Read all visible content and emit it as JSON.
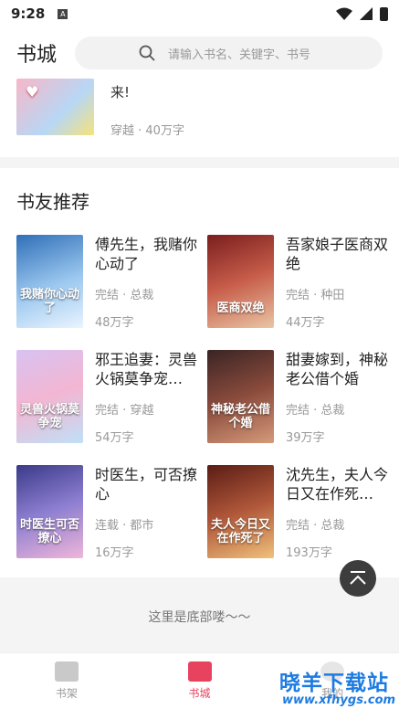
{
  "status": {
    "time": "9:28"
  },
  "header": {
    "title": "书城",
    "search_placeholder": "请输入书名、关键字、书号"
  },
  "top_book": {
    "desc": "来!",
    "meta": "穿越 · 40万字"
  },
  "section": {
    "title": "书友推荐",
    "books": [
      {
        "name": "傅先生，我赌你心动了",
        "tags": "完结 · 总裁",
        "words": "48万字",
        "cover_text": "我赌你心动了",
        "cover_color": "#6fa8dc"
      },
      {
        "name": "吾家娘子医商双绝",
        "tags": "完结 · 种田",
        "words": "44万字",
        "cover_text": "医商双绝",
        "cover_color": "#a33a3a"
      },
      {
        "name": "邪王追妻：灵兽火锅莫争宠…",
        "tags": "完结 · 穿越",
        "words": "54万字",
        "cover_text": "灵兽火锅莫争宠",
        "cover_color": "#c9a6e6"
      },
      {
        "name": "甜妻嫁到，神秘老公借个婚",
        "tags": "完结 · 总裁",
        "words": "39万字",
        "cover_text": "神秘老公借个婚",
        "cover_color": "#5a3a3a"
      },
      {
        "name": "时医生，可否撩心",
        "tags": "连载 · 都市",
        "words": "16万字",
        "cover_text": "时医生可否撩心",
        "cover_color": "#6c5fa8"
      },
      {
        "name": "沈先生，夫人今日又在作死…",
        "tags": "完结 · 总裁",
        "words": "193万字",
        "cover_text": "夫人今日又在作死了",
        "cover_color": "#8a3b2a"
      }
    ]
  },
  "footer_note": "这里是底部喽～～",
  "tabs": [
    {
      "label": "书架",
      "active": false
    },
    {
      "label": "书城",
      "active": true
    },
    {
      "label": "我的",
      "active": false
    }
  ],
  "watermark": {
    "main": "晓羊下载站",
    "url": "www.xfhygs.com"
  },
  "colors": {
    "accent": "#e8435e",
    "watermark": "#1e7be0"
  }
}
